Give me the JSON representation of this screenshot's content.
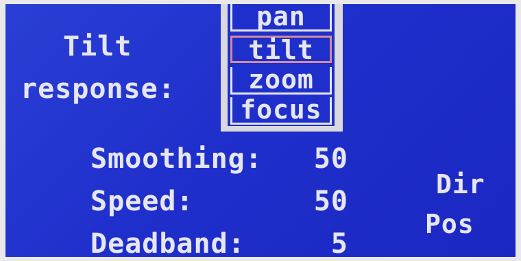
{
  "panel": {
    "title_line1": "Tilt",
    "title_line2": "response:"
  },
  "axis_menu": {
    "items": [
      {
        "label": "pan",
        "selected": false
      },
      {
        "label": "tilt",
        "selected": true
      },
      {
        "label": "zoom",
        "selected": false
      },
      {
        "label": "focus",
        "selected": false
      }
    ]
  },
  "settings": {
    "smoothing": {
      "label": "Smoothing:",
      "value": "50"
    },
    "speed": {
      "label": "Speed:",
      "value": "50"
    },
    "deadband": {
      "label": "Deadband:",
      "value": "5"
    }
  },
  "side_buttons": {
    "dir": "Dir",
    "pos": "Pos"
  },
  "colors": {
    "background": "#1f2fcb",
    "text": "#e6e6ee",
    "selection_border": "#d38a9c",
    "menu_frame": "#d9d9de"
  }
}
